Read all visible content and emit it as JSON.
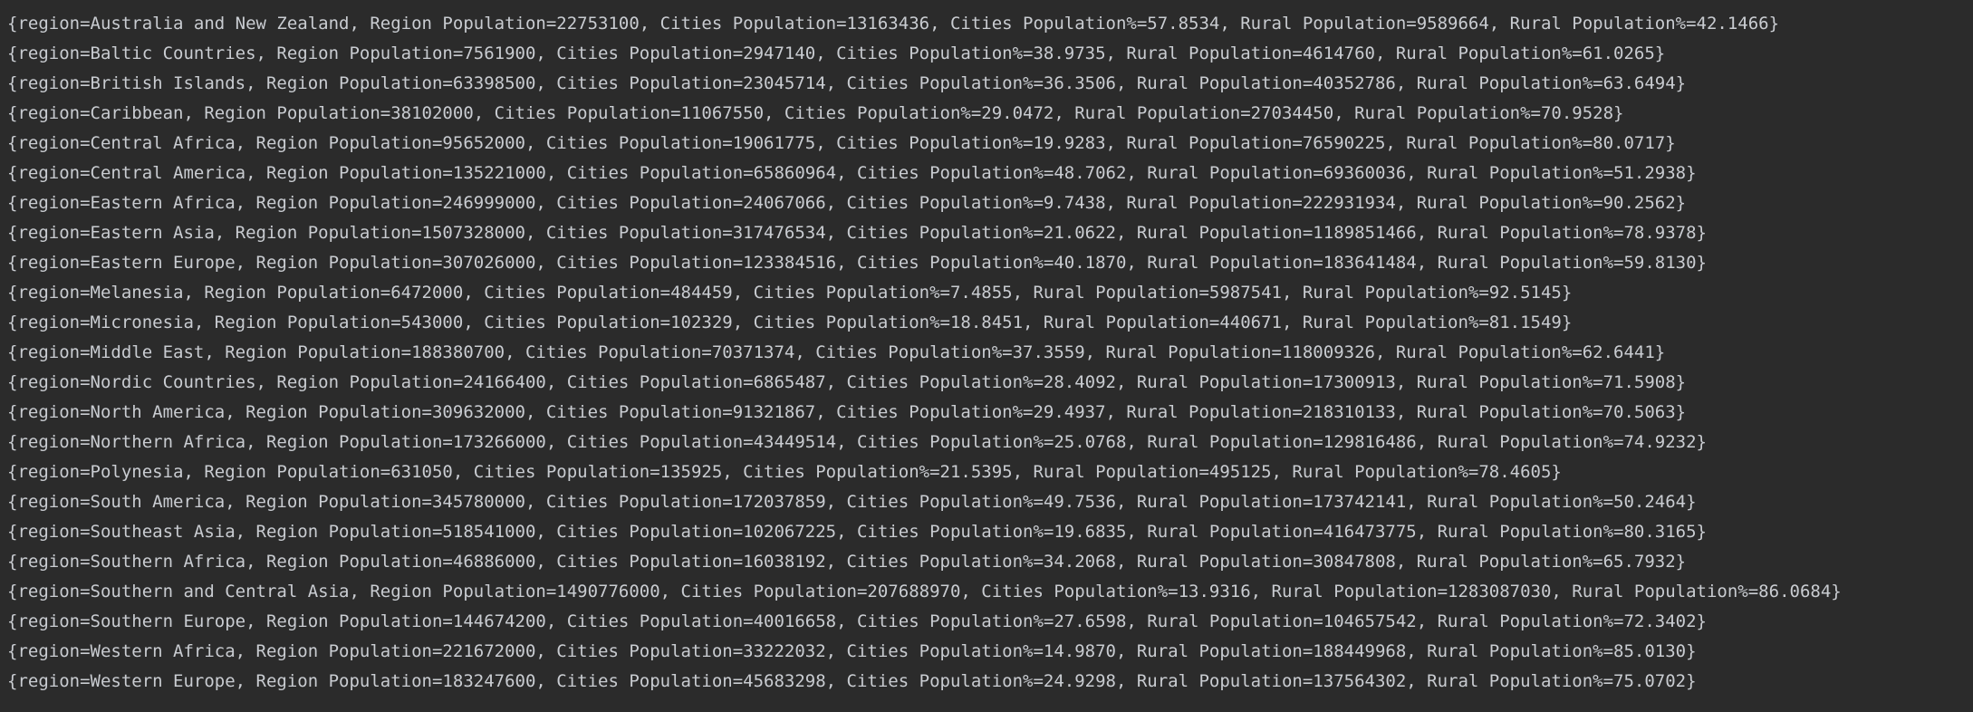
{
  "console": {
    "lines": [
      "{region=Australia and New Zealand, Region Population=22753100, Cities Population=13163436, Cities Population%=57.8534, Rural Population=9589664, Rural Population%=42.1466}",
      "{region=Baltic Countries, Region Population=7561900, Cities Population=2947140, Cities Population%=38.9735, Rural Population=4614760, Rural Population%=61.0265}",
      "{region=British Islands, Region Population=63398500, Cities Population=23045714, Cities Population%=36.3506, Rural Population=40352786, Rural Population%=63.6494}",
      "{region=Caribbean, Region Population=38102000, Cities Population=11067550, Cities Population%=29.0472, Rural Population=27034450, Rural Population%=70.9528}",
      "{region=Central Africa, Region Population=95652000, Cities Population=19061775, Cities Population%=19.9283, Rural Population=76590225, Rural Population%=80.0717}",
      "{region=Central America, Region Population=135221000, Cities Population=65860964, Cities Population%=48.7062, Rural Population=69360036, Rural Population%=51.2938}",
      "{region=Eastern Africa, Region Population=246999000, Cities Population=24067066, Cities Population%=9.7438, Rural Population=222931934, Rural Population%=90.2562}",
      "{region=Eastern Asia, Region Population=1507328000, Cities Population=317476534, Cities Population%=21.0622, Rural Population=1189851466, Rural Population%=78.9378}",
      "{region=Eastern Europe, Region Population=307026000, Cities Population=123384516, Cities Population%=40.1870, Rural Population=183641484, Rural Population%=59.8130}",
      "{region=Melanesia, Region Population=6472000, Cities Population=484459, Cities Population%=7.4855, Rural Population=5987541, Rural Population%=92.5145}",
      "{region=Micronesia, Region Population=543000, Cities Population=102329, Cities Population%=18.8451, Rural Population=440671, Rural Population%=81.1549}",
      "{region=Middle East, Region Population=188380700, Cities Population=70371374, Cities Population%=37.3559, Rural Population=118009326, Rural Population%=62.6441}",
      "{region=Nordic Countries, Region Population=24166400, Cities Population=6865487, Cities Population%=28.4092, Rural Population=17300913, Rural Population%=71.5908}",
      "{region=North America, Region Population=309632000, Cities Population=91321867, Cities Population%=29.4937, Rural Population=218310133, Rural Population%=70.5063}",
      "{region=Northern Africa, Region Population=173266000, Cities Population=43449514, Cities Population%=25.0768, Rural Population=129816486, Rural Population%=74.9232}",
      "{region=Polynesia, Region Population=631050, Cities Population=135925, Cities Population%=21.5395, Rural Population=495125, Rural Population%=78.4605}",
      "{region=South America, Region Population=345780000, Cities Population=172037859, Cities Population%=49.7536, Rural Population=173742141, Rural Population%=50.2464}",
      "{region=Southeast Asia, Region Population=518541000, Cities Population=102067225, Cities Population%=19.6835, Rural Population=416473775, Rural Population%=80.3165}",
      "{region=Southern Africa, Region Population=46886000, Cities Population=16038192, Cities Population%=34.2068, Rural Population=30847808, Rural Population%=65.7932}",
      "{region=Southern and Central Asia, Region Population=1490776000, Cities Population=207688970, Cities Population%=13.9316, Rural Population=1283087030, Rural Population%=86.0684}",
      "{region=Southern Europe, Region Population=144674200, Cities Population=40016658, Cities Population%=27.6598, Rural Population=104657542, Rural Population%=72.3402}",
      "{region=Western Africa, Region Population=221672000, Cities Population=33222032, Cities Population%=14.9870, Rural Population=188449968, Rural Population%=85.0130}",
      "{region=Western Europe, Region Population=183247600, Cities Population=45683298, Cities Population%=24.9298, Rural Population=137564302, Rural Population%=75.0702}"
    ]
  },
  "colors": {
    "background": "#2b2b2b",
    "text": "#c9ccd1"
  }
}
